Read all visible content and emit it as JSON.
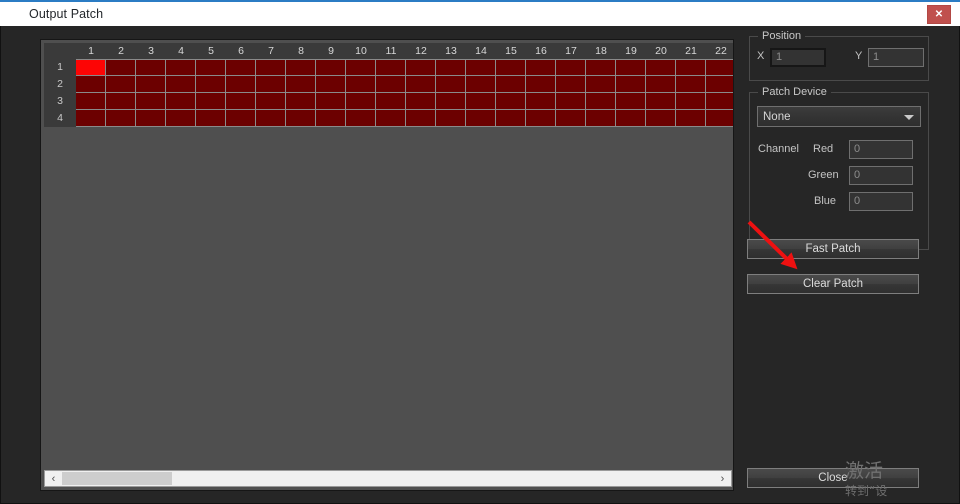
{
  "window": {
    "title": "Output Patch",
    "close_label": "✕"
  },
  "grid": {
    "columns": [
      1,
      2,
      3,
      4,
      5,
      6,
      7,
      8,
      9,
      10,
      11,
      12,
      13,
      14,
      15,
      16,
      17,
      18,
      19,
      20,
      21,
      22
    ],
    "rows": [
      1,
      2,
      3,
      4
    ],
    "selected_cell": {
      "row": 1,
      "col": 1
    },
    "cell_color": "#6c0000",
    "selected_color": "#fd0505",
    "scrollbar": {
      "left_arrow": "‹",
      "right_arrow": "›"
    }
  },
  "position_group": {
    "title": "Position",
    "x_label": "X",
    "x_value": "1",
    "y_label": "Y",
    "y_value": "1"
  },
  "patch_device_group": {
    "title": "Patch Device",
    "device_selected": "None",
    "channel_label": "Channel",
    "channels": [
      {
        "label": "Red",
        "value": "0"
      },
      {
        "label": "Green",
        "value": "0"
      },
      {
        "label": "Blue",
        "value": "0"
      }
    ]
  },
  "buttons": {
    "fast_patch": "Fast Patch",
    "clear_patch": "Clear Patch",
    "close": "Close"
  },
  "annotation": {
    "arrow_color": "#ee1111",
    "target": "Fast Patch"
  },
  "watermark": {
    "line1": "激活",
    "line2": "转到“设"
  }
}
